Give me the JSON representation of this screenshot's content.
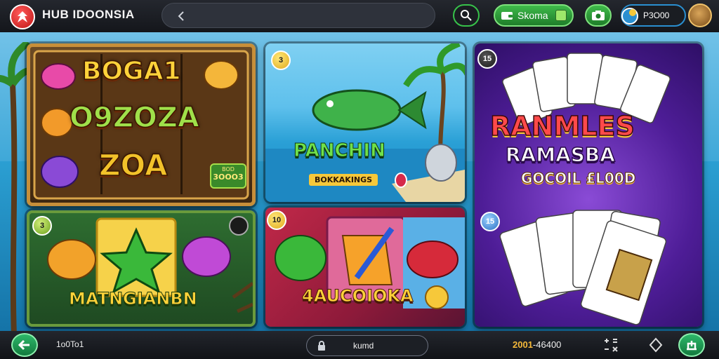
{
  "header": {
    "brand": "HUB IDOONSIA",
    "nav_label": "Skoma",
    "coins": "P3O00"
  },
  "tiles": [
    {
      "badge": "",
      "lines": [
        "BOGA1",
        "O9ZOZA",
        "ZOA"
      ],
      "tag": "3OOO3",
      "chip": "BOD"
    },
    {
      "badge": "3",
      "title": "PANCHIN",
      "subtitle": "BOKKAKINGS"
    },
    {
      "badge": "15",
      "title_top": "RANMLES",
      "title_mid": "RAMASBA",
      "subtitle": "GOCOIL £L00D",
      "badge_lower": "15"
    },
    {
      "badge": "3",
      "title": "MATNGIANBN"
    },
    {
      "badge": "10",
      "title": "4AUCOIOKA"
    }
  ],
  "footer": {
    "left_value": "1o0To1",
    "input_value": "kumd",
    "score_main": "2001",
    "score_rest": "-46400"
  },
  "colors": {
    "accent_green": "#2db86a",
    "accent_gold": "#f6b93a",
    "accent_blue": "#2a8fd0"
  },
  "icons": [
    "logo-icon",
    "back-icon",
    "search-icon",
    "wallet-icon",
    "camera-icon",
    "coin-icon",
    "avatar",
    "arrow-left-icon",
    "lock-icon",
    "grid-icon",
    "diamond-icon",
    "home-icon"
  ]
}
